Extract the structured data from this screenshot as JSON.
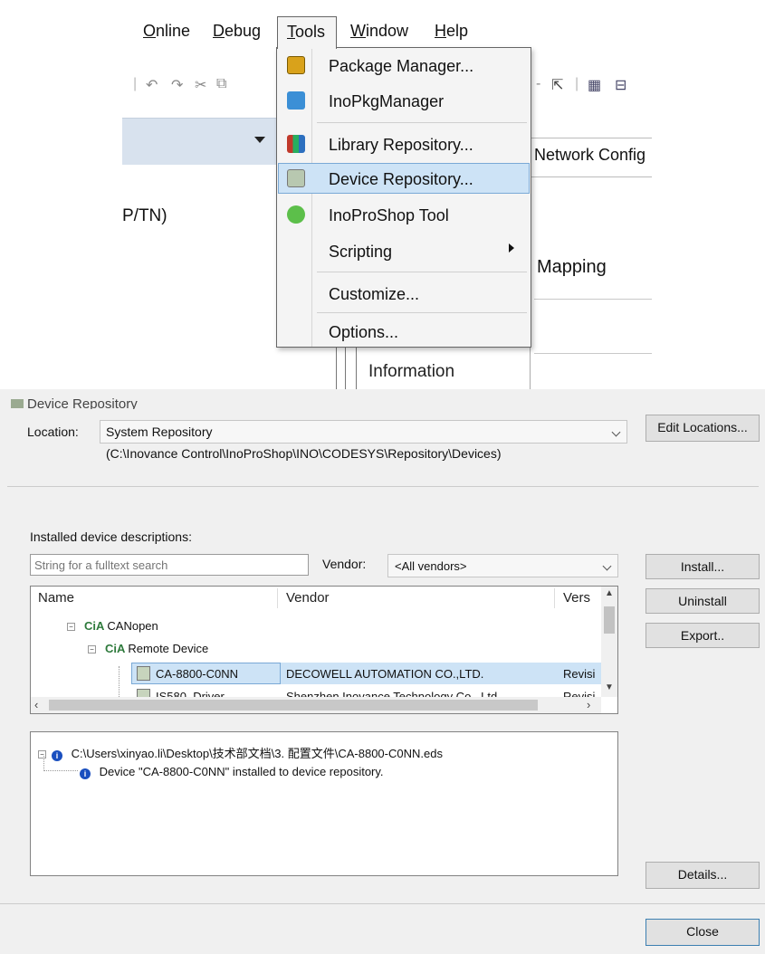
{
  "menubar": {
    "online": "Online",
    "debug": "Debug",
    "tools": "Tools",
    "window": "Window",
    "help": "Help"
  },
  "behind": {
    "network_config": "Network Config",
    "tn_text": "P/TN)",
    "mapping": "Mapping",
    "information": "Information"
  },
  "tools_menu": {
    "items": [
      {
        "label": "Package Manager...",
        "icon": "package-icon"
      },
      {
        "label": "InoPkgManager",
        "icon": "pkg-manager-icon"
      },
      {
        "label": "Library Repository...",
        "icon": "library-icon"
      },
      {
        "label": "Device Repository...",
        "icon": "device-repository-icon",
        "selected": true
      },
      {
        "label": "InoProShop Tool",
        "icon": "inoproshop-icon"
      },
      {
        "label": "Scripting",
        "icon": "",
        "submenu": true
      },
      {
        "label": "Customize...",
        "icon": ""
      },
      {
        "label": "Options...",
        "icon": ""
      }
    ]
  },
  "dialog": {
    "title": "Device Repository",
    "location_label": "Location:",
    "location_value": "System Repository",
    "location_path": "(C:\\Inovance Control\\InoProShop\\INO\\CODESYS\\Repository\\Devices)",
    "edit_locations": "Edit Locations...",
    "installed_label": "Installed device descriptions:",
    "search_placeholder": "String for a fulltext search",
    "vendor_label": "Vendor:",
    "vendor_value": "<All vendors>",
    "install": "Install...",
    "uninstall": "Uninstall",
    "export": "Export..",
    "details": "Details...",
    "close": "Close",
    "columns": {
      "name": "Name",
      "vendor": "Vendor",
      "version": "Vers"
    },
    "tree": {
      "canopen": "CANopen",
      "remote_device": "Remote Device",
      "rows": [
        {
          "name": "CA-8800-C0NN",
          "vendor": "DECOWELL AUTOMATION CO.,LTD.",
          "version": "Revisi"
        },
        {
          "name": "IS580_Driver",
          "vendor": "Shenzhen Inovance Technology Co., Ltd",
          "version": "Revisi"
        }
      ]
    },
    "log": {
      "path": "C:\\Users\\xinyao.li\\Desktop\\技术部文档\\3. 配置文件\\CA-8800-C0NN.eds",
      "message": "Device \"CA-8800-C0NN\" installed to device repository."
    }
  },
  "colors": {
    "menu_highlight": "#cde3f6",
    "row_highlight": "#cde3f6",
    "info_icon": "#1a4fbf"
  }
}
